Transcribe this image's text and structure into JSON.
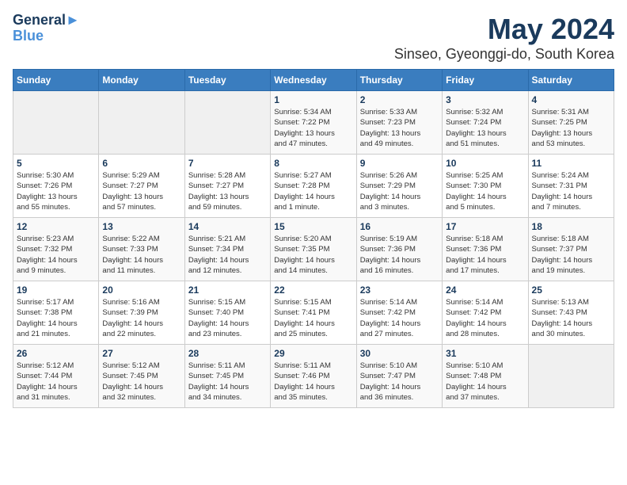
{
  "logo": {
    "line1": "General",
    "line2": "Blue"
  },
  "title": "May 2024",
  "location": "Sinseo, Gyeonggi-do, South Korea",
  "days_of_week": [
    "Sunday",
    "Monday",
    "Tuesday",
    "Wednesday",
    "Thursday",
    "Friday",
    "Saturday"
  ],
  "weeks": [
    [
      {
        "day": "",
        "info": ""
      },
      {
        "day": "",
        "info": ""
      },
      {
        "day": "",
        "info": ""
      },
      {
        "day": "1",
        "info": "Sunrise: 5:34 AM\nSunset: 7:22 PM\nDaylight: 13 hours\nand 47 minutes."
      },
      {
        "day": "2",
        "info": "Sunrise: 5:33 AM\nSunset: 7:23 PM\nDaylight: 13 hours\nand 49 minutes."
      },
      {
        "day": "3",
        "info": "Sunrise: 5:32 AM\nSunset: 7:24 PM\nDaylight: 13 hours\nand 51 minutes."
      },
      {
        "day": "4",
        "info": "Sunrise: 5:31 AM\nSunset: 7:25 PM\nDaylight: 13 hours\nand 53 minutes."
      }
    ],
    [
      {
        "day": "5",
        "info": "Sunrise: 5:30 AM\nSunset: 7:26 PM\nDaylight: 13 hours\nand 55 minutes."
      },
      {
        "day": "6",
        "info": "Sunrise: 5:29 AM\nSunset: 7:27 PM\nDaylight: 13 hours\nand 57 minutes."
      },
      {
        "day": "7",
        "info": "Sunrise: 5:28 AM\nSunset: 7:27 PM\nDaylight: 13 hours\nand 59 minutes."
      },
      {
        "day": "8",
        "info": "Sunrise: 5:27 AM\nSunset: 7:28 PM\nDaylight: 14 hours\nand 1 minute."
      },
      {
        "day": "9",
        "info": "Sunrise: 5:26 AM\nSunset: 7:29 PM\nDaylight: 14 hours\nand 3 minutes."
      },
      {
        "day": "10",
        "info": "Sunrise: 5:25 AM\nSunset: 7:30 PM\nDaylight: 14 hours\nand 5 minutes."
      },
      {
        "day": "11",
        "info": "Sunrise: 5:24 AM\nSunset: 7:31 PM\nDaylight: 14 hours\nand 7 minutes."
      }
    ],
    [
      {
        "day": "12",
        "info": "Sunrise: 5:23 AM\nSunset: 7:32 PM\nDaylight: 14 hours\nand 9 minutes."
      },
      {
        "day": "13",
        "info": "Sunrise: 5:22 AM\nSunset: 7:33 PM\nDaylight: 14 hours\nand 11 minutes."
      },
      {
        "day": "14",
        "info": "Sunrise: 5:21 AM\nSunset: 7:34 PM\nDaylight: 14 hours\nand 12 minutes."
      },
      {
        "day": "15",
        "info": "Sunrise: 5:20 AM\nSunset: 7:35 PM\nDaylight: 14 hours\nand 14 minutes."
      },
      {
        "day": "16",
        "info": "Sunrise: 5:19 AM\nSunset: 7:36 PM\nDaylight: 14 hours\nand 16 minutes."
      },
      {
        "day": "17",
        "info": "Sunrise: 5:18 AM\nSunset: 7:36 PM\nDaylight: 14 hours\nand 17 minutes."
      },
      {
        "day": "18",
        "info": "Sunrise: 5:18 AM\nSunset: 7:37 PM\nDaylight: 14 hours\nand 19 minutes."
      }
    ],
    [
      {
        "day": "19",
        "info": "Sunrise: 5:17 AM\nSunset: 7:38 PM\nDaylight: 14 hours\nand 21 minutes."
      },
      {
        "day": "20",
        "info": "Sunrise: 5:16 AM\nSunset: 7:39 PM\nDaylight: 14 hours\nand 22 minutes."
      },
      {
        "day": "21",
        "info": "Sunrise: 5:15 AM\nSunset: 7:40 PM\nDaylight: 14 hours\nand 23 minutes."
      },
      {
        "day": "22",
        "info": "Sunrise: 5:15 AM\nSunset: 7:41 PM\nDaylight: 14 hours\nand 25 minutes."
      },
      {
        "day": "23",
        "info": "Sunrise: 5:14 AM\nSunset: 7:42 PM\nDaylight: 14 hours\nand 27 minutes."
      },
      {
        "day": "24",
        "info": "Sunrise: 5:14 AM\nSunset: 7:42 PM\nDaylight: 14 hours\nand 28 minutes."
      },
      {
        "day": "25",
        "info": "Sunrise: 5:13 AM\nSunset: 7:43 PM\nDaylight: 14 hours\nand 30 minutes."
      }
    ],
    [
      {
        "day": "26",
        "info": "Sunrise: 5:12 AM\nSunset: 7:44 PM\nDaylight: 14 hours\nand 31 minutes."
      },
      {
        "day": "27",
        "info": "Sunrise: 5:12 AM\nSunset: 7:45 PM\nDaylight: 14 hours\nand 32 minutes."
      },
      {
        "day": "28",
        "info": "Sunrise: 5:11 AM\nSunset: 7:45 PM\nDaylight: 14 hours\nand 34 minutes."
      },
      {
        "day": "29",
        "info": "Sunrise: 5:11 AM\nSunset: 7:46 PM\nDaylight: 14 hours\nand 35 minutes."
      },
      {
        "day": "30",
        "info": "Sunrise: 5:10 AM\nSunset: 7:47 PM\nDaylight: 14 hours\nand 36 minutes."
      },
      {
        "day": "31",
        "info": "Sunrise: 5:10 AM\nSunset: 7:48 PM\nDaylight: 14 hours\nand 37 minutes."
      },
      {
        "day": "",
        "info": ""
      }
    ]
  ]
}
